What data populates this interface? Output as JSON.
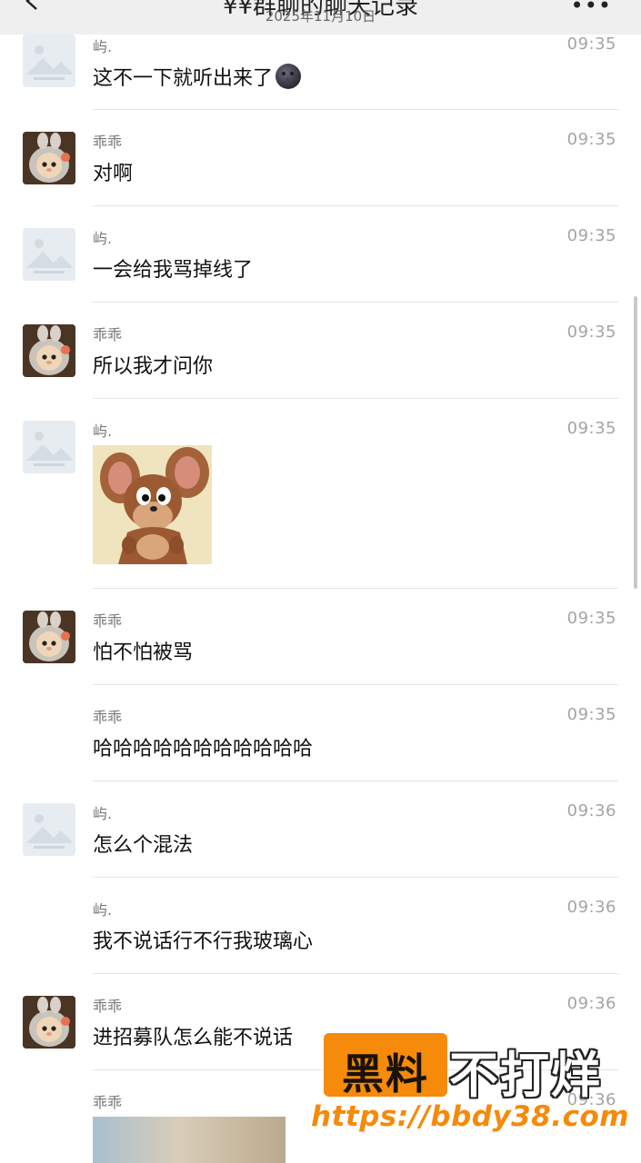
{
  "header": {
    "title": "¥¥群聊的聊天记录",
    "date": "2025年11月10日",
    "back_icon": "chevron-left-icon",
    "more_icon": "more-dots-icon",
    "more_label": "•••"
  },
  "messages": [
    {
      "sender": "屿.",
      "time": "09:35",
      "text": "这不一下就听出来了",
      "avatar": "default",
      "emoji": "new-moon-face-emoji"
    },
    {
      "sender": "乖乖",
      "time": "09:35",
      "text": "对啊",
      "avatar": "cute"
    },
    {
      "sender": "屿.",
      "time": "09:35",
      "text": "一会给我骂掉线了",
      "avatar": "default"
    },
    {
      "sender": "乖乖",
      "time": "09:35",
      "text": "所以我才问你",
      "avatar": "cute"
    },
    {
      "sender": "屿.",
      "time": "09:35",
      "text": "",
      "avatar": "default",
      "image": "jerry-mouse-sticker"
    },
    {
      "sender": "乖乖",
      "time": "09:35",
      "text": "怕不怕被骂",
      "avatar": "cute"
    },
    {
      "sender": "乖乖",
      "time": "09:35",
      "text": "哈哈哈哈哈哈哈哈哈哈哈",
      "avatar": "none"
    },
    {
      "sender": "屿.",
      "time": "09:36",
      "text": "怎么个混法",
      "avatar": "default"
    },
    {
      "sender": "屿.",
      "time": "09:36",
      "text": "我不说话行不行我玻璃心",
      "avatar": "none"
    },
    {
      "sender": "乖乖",
      "time": "09:36",
      "text": "进招募队怎么能不说话",
      "avatar": "cute"
    },
    {
      "sender": "乖乖",
      "time": "09:36",
      "text": "",
      "avatar": "none",
      "image": "blurred-photo"
    }
  ],
  "watermark": {
    "box_text": "黑料",
    "right_text": "不打烊",
    "url": "https://bbdy38.com",
    "color": "#f58a0b"
  }
}
